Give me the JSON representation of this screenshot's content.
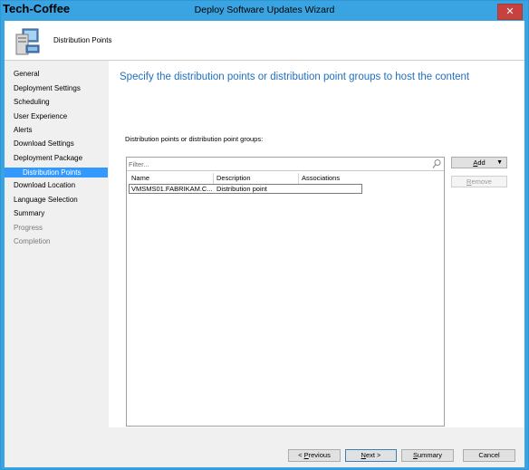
{
  "watermark": "Tech-Coffee",
  "window": {
    "title": "Deploy Software Updates Wizard",
    "close_glyph": "✕"
  },
  "header": {
    "page_title": "Distribution Points",
    "icon": "computer-icon"
  },
  "nav": {
    "items": [
      {
        "label": "General",
        "state": "done"
      },
      {
        "label": "Deployment Settings",
        "state": "done"
      },
      {
        "label": "Scheduling",
        "state": "done"
      },
      {
        "label": "User Experience",
        "state": "done"
      },
      {
        "label": "Alerts",
        "state": "done"
      },
      {
        "label": "Download Settings",
        "state": "done"
      },
      {
        "label": "Deployment Package",
        "state": "done"
      },
      {
        "label": "Distribution Points",
        "state": "selected"
      },
      {
        "label": "Download Location",
        "state": "done"
      },
      {
        "label": "Language Selection",
        "state": "done"
      },
      {
        "label": "Summary",
        "state": "done"
      },
      {
        "label": "Progress",
        "state": "disabled"
      },
      {
        "label": "Completion",
        "state": "disabled"
      }
    ]
  },
  "main": {
    "heading": "Specify the distribution points or distribution point groups to host the content",
    "list_label": "Distribution points or distribution point groups:",
    "filter_placeholder": "Filter...",
    "columns": [
      "Name",
      "Description",
      "Associations"
    ],
    "rows": [
      {
        "name": "VMSMS01.FABRIKAM.C...",
        "description": "Distribution point",
        "associations": ""
      }
    ],
    "add_button": {
      "pre": "",
      "accel": "A",
      "post": "dd",
      "arrow": "▼"
    },
    "remove_button": {
      "pre": "",
      "accel": "R",
      "post": "emove"
    }
  },
  "footer": {
    "previous": {
      "pre": "< ",
      "accel": "P",
      "post": "revious"
    },
    "next": {
      "pre": "",
      "accel": "N",
      "post": "ext >"
    },
    "summary": {
      "pre": "",
      "accel": "S",
      "post": "ummary"
    },
    "cancel": {
      "pre": "",
      "accel": "",
      "post": "Cancel"
    }
  },
  "colors": {
    "titlebar": "#3aa4e2",
    "heading": "#1f6fbf",
    "selected_nav": "#3399ff",
    "close_button": "#c7413e"
  }
}
